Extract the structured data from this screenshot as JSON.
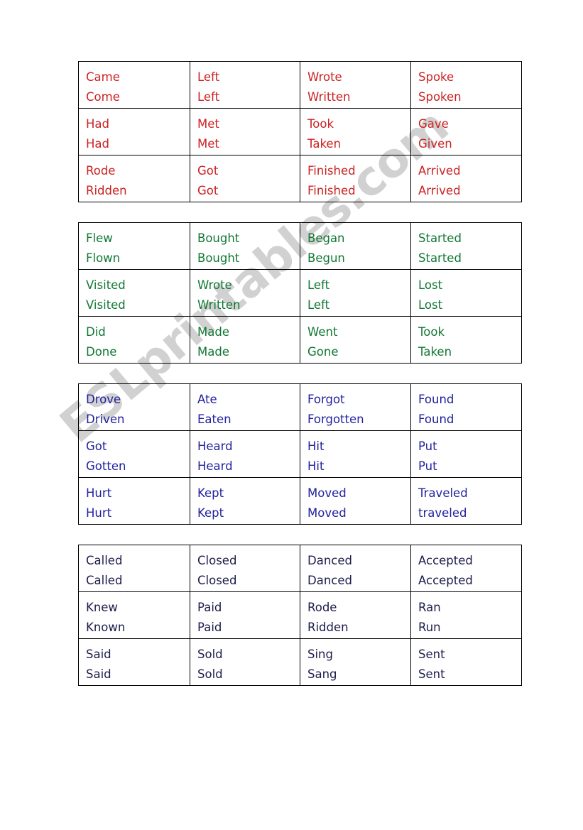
{
  "page": {
    "type": "esl-worksheet",
    "title": "Irregular and regular verbs: past simple / past participle cards",
    "background": "#ffffff"
  },
  "watermark": {
    "text": "ESLprintables.com",
    "color": "rgba(0,0,0,0.18)",
    "rotation_degrees": -40
  },
  "tables": [
    {
      "id": "table-red",
      "color": "#CC2222",
      "rows": [
        [
          {
            "past": "Came",
            "participle": "Come"
          },
          {
            "past": "Left",
            "participle": "Left"
          },
          {
            "past": "Wrote",
            "participle": "Written"
          },
          {
            "past": "Spoke",
            "participle": "Spoken"
          }
        ],
        [
          {
            "past": "Had",
            "participle": "Had"
          },
          {
            "past": "Met",
            "participle": "Met"
          },
          {
            "past": "Took",
            "participle": "Taken"
          },
          {
            "past": "Gave",
            "participle": "Given"
          }
        ],
        [
          {
            "past": "Rode",
            "participle": "Ridden"
          },
          {
            "past": "Got",
            "participle": "Got"
          },
          {
            "past": "Finished",
            "participle": "Finished"
          },
          {
            "past": "Arrived",
            "participle": "Arrived"
          }
        ]
      ]
    },
    {
      "id": "table-green",
      "color": "#117733",
      "rows": [
        [
          {
            "past": "Flew",
            "participle": "Flown"
          },
          {
            "past": "Bought",
            "participle": "Bought"
          },
          {
            "past": "Began",
            "participle": "Begun"
          },
          {
            "past": "Started",
            "participle": "Started"
          }
        ],
        [
          {
            "past": "Visited",
            "participle": "Visited"
          },
          {
            "past": "Wrote",
            "participle": "Written"
          },
          {
            "past": "Left",
            "participle": "Left"
          },
          {
            "past": "Lost",
            "participle": "Lost"
          }
        ],
        [
          {
            "past": "Did",
            "participle": "Done"
          },
          {
            "past": "Made",
            "participle": "Made"
          },
          {
            "past": "Went",
            "participle": "Gone"
          },
          {
            "past": "Took",
            "participle": "Taken"
          }
        ]
      ]
    },
    {
      "id": "table-blue",
      "color": "#22229E",
      "rows": [
        [
          {
            "past": "Drove",
            "participle": "Driven"
          },
          {
            "past": "Ate",
            "participle": "Eaten"
          },
          {
            "past": "Forgot",
            "participle": "Forgotten"
          },
          {
            "past": "Found",
            "participle": "Found"
          }
        ],
        [
          {
            "past": "Got",
            "participle": "Gotten"
          },
          {
            "past": "Heard",
            "participle": "Heard"
          },
          {
            "past": "Hit",
            "participle": "Hit"
          },
          {
            "past": "Put",
            "participle": "Put"
          }
        ],
        [
          {
            "past": "Hurt",
            "participle": "Hurt"
          },
          {
            "past": "Kept",
            "participle": "Kept"
          },
          {
            "past": "Moved",
            "participle": "Moved"
          },
          {
            "past": "Traveled",
            "participle": "traveled"
          }
        ]
      ]
    },
    {
      "id": "table-navy",
      "color": "#1C1C4A",
      "rows": [
        [
          {
            "past": "Called",
            "participle": "Called"
          },
          {
            "past": "Closed",
            "participle": "Closed"
          },
          {
            "past": "Danced",
            "participle": "Danced"
          },
          {
            "past": "Accepted",
            "participle": "Accepted"
          }
        ],
        [
          {
            "past": "Knew",
            "participle": "Known"
          },
          {
            "past": "Paid",
            "participle": "Paid"
          },
          {
            "past": "Rode",
            "participle": "Ridden"
          },
          {
            "past": "Ran",
            "participle": "Run"
          }
        ],
        [
          {
            "past": "Said",
            "participle": "Said"
          },
          {
            "past": "Sold",
            "participle": "Sold"
          },
          {
            "past": "Sing",
            "participle": "Sang"
          },
          {
            "past": "Sent",
            "participle": "Sent"
          }
        ]
      ]
    }
  ]
}
